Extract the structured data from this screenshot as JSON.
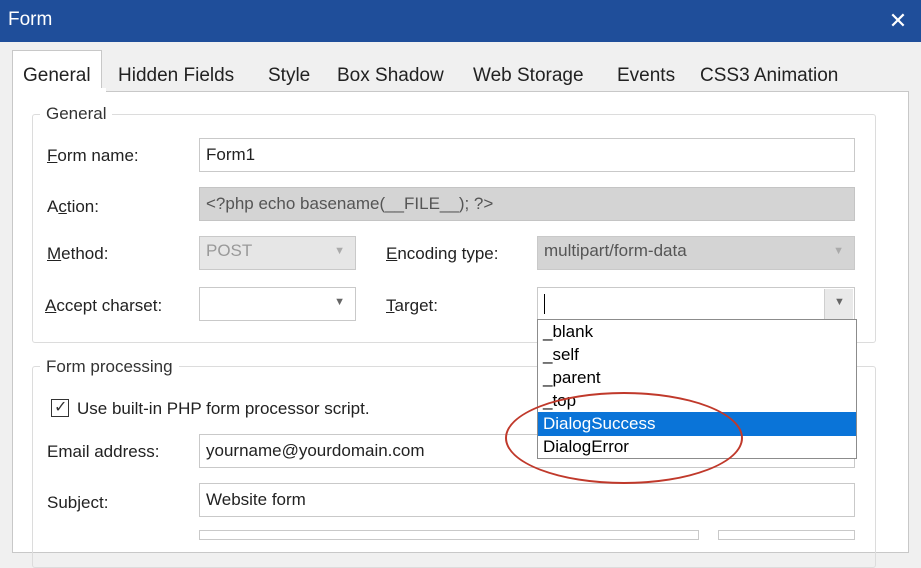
{
  "window": {
    "title": "Form",
    "close_glyph": "✕",
    "close_icon": "close-icon"
  },
  "tabs": [
    {
      "label": "General",
      "active": true
    },
    {
      "label": "Hidden Fields"
    },
    {
      "label": "Style"
    },
    {
      "label": "Box Shadow"
    },
    {
      "label": "Web Storage"
    },
    {
      "label": "Events"
    },
    {
      "label": "CSS3 Animation"
    }
  ],
  "general": {
    "group_title": "General",
    "form_name": {
      "label_u": "F",
      "label_rest": "orm name:",
      "value": "Form1"
    },
    "action": {
      "label_pre": "A",
      "label_u": "c",
      "label_rest": "tion:",
      "value": "<?php echo basename(__FILE__); ?>"
    },
    "method": {
      "label_u": "M",
      "label_rest": "ethod:",
      "value": "POST"
    },
    "encoding": {
      "label_u": "E",
      "label_rest": "ncoding type:",
      "value": "multipart/form-data"
    },
    "charset": {
      "label_u": "A",
      "label_rest": "ccept charset:",
      "value": ""
    },
    "target": {
      "label_u": "T",
      "label_rest": "arget:",
      "value": "",
      "options": [
        "_blank",
        "_self",
        "_parent",
        "_top",
        "DialogSuccess",
        "DialogError"
      ],
      "highlighted": "DialogSuccess"
    }
  },
  "processing": {
    "group_title": "Form processing",
    "builtin_label": "Use built-in PHP form processor script.",
    "builtin_checked": true,
    "email": {
      "label": "Email address:",
      "value": "yourname@yourdomain.com"
    },
    "subject": {
      "label": "Subject:",
      "value": "Website form"
    }
  },
  "colors": {
    "titlebar": "#1f4e9a",
    "highlight": "#0a74d8",
    "annotation": "#c0392b"
  }
}
